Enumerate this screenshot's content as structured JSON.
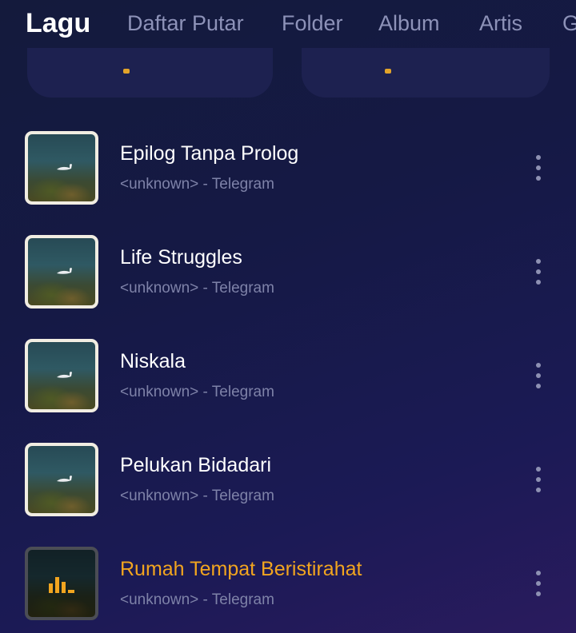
{
  "tabs": [
    {
      "label": "Lagu",
      "active": true
    },
    {
      "label": "Daftar Putar",
      "active": false
    },
    {
      "label": "Folder",
      "active": false
    },
    {
      "label": "Album",
      "active": false
    },
    {
      "label": "Artis",
      "active": false
    },
    {
      "label": "G",
      "active": false
    }
  ],
  "songs": [
    {
      "title": "Epilog Tanpa Prolog",
      "subtitle": "<unknown> - Telegram",
      "playing": false
    },
    {
      "title": "Life Struggles",
      "subtitle": "<unknown> - Telegram",
      "playing": false
    },
    {
      "title": "Niskala",
      "subtitle": "<unknown> - Telegram",
      "playing": false
    },
    {
      "title": "Pelukan Bidadari",
      "subtitle": "<unknown> - Telegram",
      "playing": false
    },
    {
      "title": "Rumah Tempat Beristirahat",
      "subtitle": "<unknown> - Telegram",
      "playing": true
    }
  ],
  "icons": {
    "more": "more-vertical-icon",
    "playing": "equalizer-icon"
  },
  "colors": {
    "accent": "#f2a51f",
    "subtitle": "#7e82a8",
    "inactive_tab": "#8d92b8"
  }
}
